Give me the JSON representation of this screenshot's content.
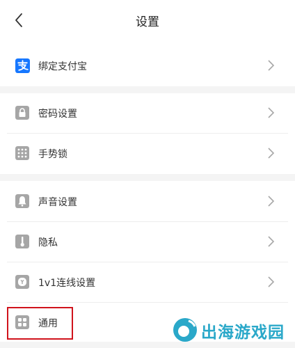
{
  "header": {
    "title": "设置"
  },
  "settings": {
    "alipay": "绑定支付宝",
    "password": "密码设置",
    "gesture": "手势锁",
    "sound": "声音设置",
    "privacy": "隐私",
    "connect": "1v1连线设置",
    "general": "通用"
  },
  "watermark": {
    "text": "出海游戏园"
  },
  "colors": {
    "alipay_blue": "#1677ff",
    "icon_gray": "#a6a6a6",
    "highlight_red": "#d0131c",
    "watermark_blue": "#2aa8c9"
  }
}
